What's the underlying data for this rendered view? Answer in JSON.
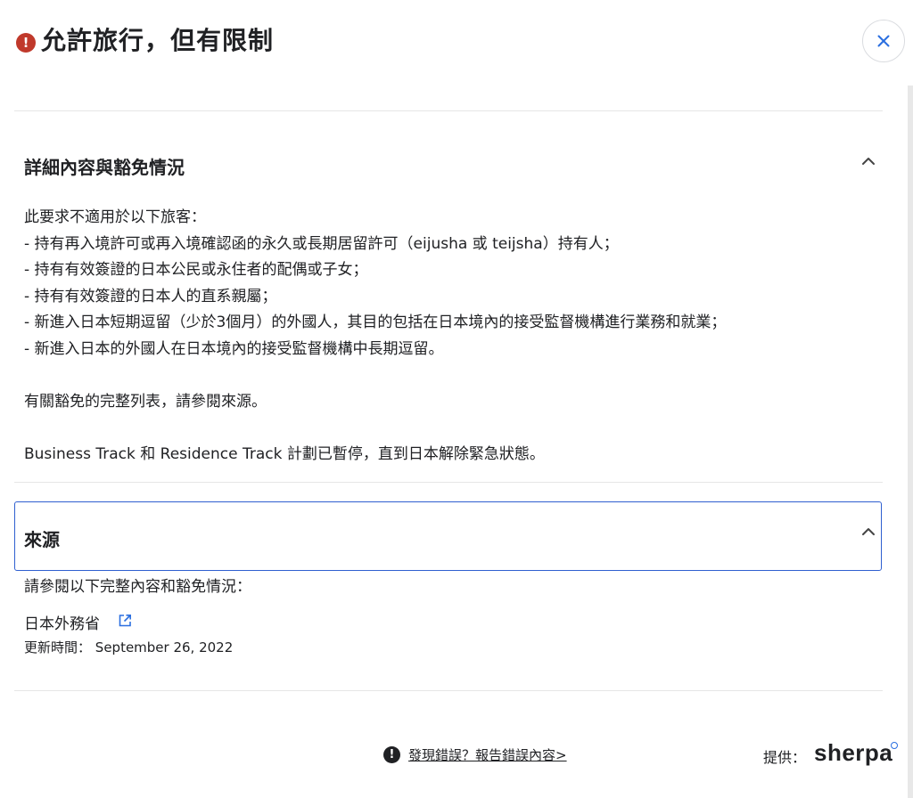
{
  "header": {
    "title": "允許旅行，但有限制",
    "status_icon": "exclamation-circle-icon",
    "status_color": "#c0392b",
    "close_icon": "close-icon",
    "close_color": "#2b6fe0"
  },
  "details": {
    "heading": "詳細內容與豁免情況",
    "expanded": true,
    "intro": "此要求不適用於以下旅客：",
    "items": [
      "- 持有再入境許可或再入境確認函的永久或長期居留許可（eijusha 或 teijsha）持有人；",
      "- 持有有效簽證的日本公民或永住者的配偶或子女；",
      "- 持有有效簽證的日本人的直系親屬；",
      "- 新進入日本短期逗留（少於3個月）的外國人，其目的包括在日本境內的接受監督機構進行業務和就業；",
      "- 新進入日本的外國人在日本境內的接受監督機構中長期逗留。"
    ],
    "full_list_note": "有關豁免的完整列表，請參閱來源。",
    "suspension_note": "Business Track 和 Residence Track 計劃已暫停，直到日本解除緊急狀態。"
  },
  "sources": {
    "heading": "來源",
    "expanded": true,
    "intro": "請參閱以下完整內容和豁免情況：",
    "link_label": "日本外務省",
    "link_icon": "external-link-icon",
    "updated_label": "更新時間：",
    "updated_date": "September 26, 2022",
    "accent_color": "#2f5fd0"
  },
  "footer": {
    "report_icon": "exclamation-circle-icon",
    "report_link": "發現錯誤？報告錯誤內容>",
    "provided_by": "提供：",
    "brand": "sherpa"
  }
}
